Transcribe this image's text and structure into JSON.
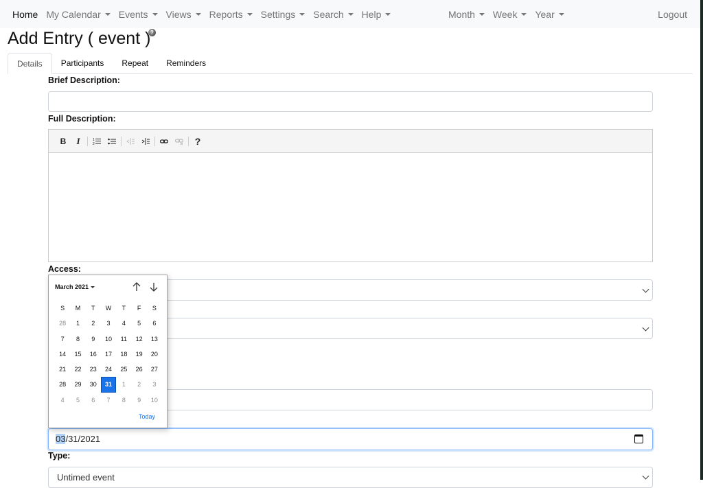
{
  "navbar": {
    "left_items": [
      {
        "label": "Home",
        "dropdown": false,
        "active": true
      },
      {
        "label": "My Calendar",
        "dropdown": true
      },
      {
        "label": "Events",
        "dropdown": true
      },
      {
        "label": "Views",
        "dropdown": true
      },
      {
        "label": "Reports",
        "dropdown": true
      },
      {
        "label": "Settings",
        "dropdown": true
      },
      {
        "label": "Search",
        "dropdown": true
      },
      {
        "label": "Help",
        "dropdown": true
      }
    ],
    "mid_items": [
      {
        "label": "Month",
        "dropdown": true
      },
      {
        "label": "Week",
        "dropdown": true
      },
      {
        "label": "Year",
        "dropdown": true
      }
    ],
    "logout_label": "Logout"
  },
  "page": {
    "title": "Add Entry ( event )",
    "help_icon": "?"
  },
  "tabs": [
    {
      "label": "Details",
      "active": true
    },
    {
      "label": "Participants"
    },
    {
      "label": "Repeat"
    },
    {
      "label": "Reminders"
    }
  ],
  "form": {
    "brief_description_label": "Brief Description:",
    "brief_description_value": "",
    "full_description_label": "Full Description:",
    "full_description_value": "",
    "editor_toolbar": [
      {
        "name": "bold-button",
        "glyph": "B",
        "disabled": false
      },
      {
        "name": "italic-button",
        "glyph": "I",
        "disabled": false
      },
      {
        "sep": true
      },
      {
        "name": "ordered-list-button",
        "glyph": "ordered-list",
        "disabled": false
      },
      {
        "name": "unordered-list-button",
        "glyph": "unordered-list",
        "disabled": false
      },
      {
        "sep": true
      },
      {
        "name": "outdent-button",
        "glyph": "outdent",
        "disabled": true
      },
      {
        "name": "indent-button",
        "glyph": "indent",
        "disabled": false
      },
      {
        "sep": true
      },
      {
        "name": "link-button",
        "glyph": "link",
        "disabled": false
      },
      {
        "name": "unlink-button",
        "glyph": "unlink",
        "disabled": true
      },
      {
        "sep": true
      },
      {
        "name": "help-button",
        "glyph": "?",
        "disabled": false
      }
    ],
    "access_label": "Access:",
    "date_value": {
      "month": "03",
      "rest": "/31/2021"
    },
    "type_label": "Type:",
    "type_value": "Untimed event"
  },
  "datepicker": {
    "month_label": "March 2021",
    "weekdays": [
      "S",
      "M",
      "T",
      "W",
      "T",
      "F",
      "S"
    ],
    "days": [
      {
        "d": "28",
        "other": true
      },
      {
        "d": "1"
      },
      {
        "d": "2"
      },
      {
        "d": "3"
      },
      {
        "d": "4"
      },
      {
        "d": "5"
      },
      {
        "d": "6"
      },
      {
        "d": "7"
      },
      {
        "d": "8"
      },
      {
        "d": "9"
      },
      {
        "d": "10"
      },
      {
        "d": "11"
      },
      {
        "d": "12"
      },
      {
        "d": "13"
      },
      {
        "d": "14"
      },
      {
        "d": "15"
      },
      {
        "d": "16"
      },
      {
        "d": "17"
      },
      {
        "d": "18"
      },
      {
        "d": "19"
      },
      {
        "d": "20"
      },
      {
        "d": "21"
      },
      {
        "d": "22"
      },
      {
        "d": "23"
      },
      {
        "d": "24"
      },
      {
        "d": "25"
      },
      {
        "d": "26"
      },
      {
        "d": "27"
      },
      {
        "d": "28"
      },
      {
        "d": "29"
      },
      {
        "d": "30"
      },
      {
        "d": "31",
        "selected": true
      },
      {
        "d": "1",
        "other": true
      },
      {
        "d": "2",
        "other": true
      },
      {
        "d": "3",
        "other": true
      },
      {
        "d": "4",
        "other": true
      },
      {
        "d": "5",
        "other": true
      },
      {
        "d": "6",
        "other": true
      },
      {
        "d": "7",
        "other": true
      },
      {
        "d": "8",
        "other": true
      },
      {
        "d": "9",
        "other": true
      },
      {
        "d": "10",
        "other": true
      }
    ],
    "today_label": "Today",
    "accent_color": "#1a73e8"
  }
}
